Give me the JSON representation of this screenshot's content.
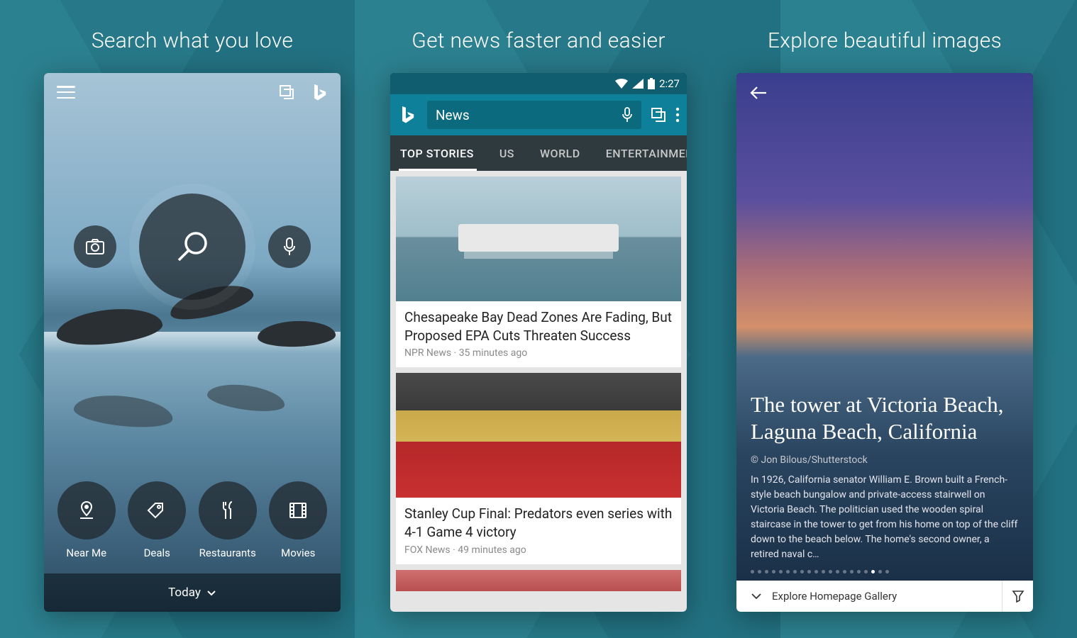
{
  "columns": {
    "search": {
      "title": "Search what you love"
    },
    "news": {
      "title": "Get news faster and easier"
    },
    "gallery": {
      "title": "Explore beautiful images"
    }
  },
  "phone1": {
    "grid": [
      {
        "label": "Near Me"
      },
      {
        "label": "Deals"
      },
      {
        "label": "Restaurants"
      },
      {
        "label": "Movies"
      }
    ],
    "bottom_label": "Today"
  },
  "phone2": {
    "status_time": "2:27",
    "search_value": "News",
    "tabs": [
      {
        "label": "TOP STORIES",
        "active": true
      },
      {
        "label": "US"
      },
      {
        "label": "WORLD"
      },
      {
        "label": "ENTERTAINMENT"
      }
    ],
    "articles": [
      {
        "title": "Chesapeake Bay Dead Zones Are Fading, But Proposed EPA Cuts Threaten Success",
        "source": "NPR News",
        "time": "35 minutes ago"
      },
      {
        "title": "Stanley Cup Final: Predators even series with 4-1 Game 4 victory",
        "source": "FOX News",
        "time": "49 minutes ago"
      }
    ]
  },
  "phone3": {
    "title": "The tower at Victoria Beach, Laguna Beach, California",
    "credit": "©   Jon Bilous/Shutterstock",
    "description": "In 1926, California senator William E. Brown built a French-style beach bungalow and private-access stairwell on Victoria Beach. The politician used the wooden spiral staircase in the tower to get from his home on top of the cliff down to the beach below. The home's second owner, a retired naval c…",
    "dot_count": 20,
    "active_dot": 17,
    "bottom_label": "Explore Homepage Gallery"
  }
}
